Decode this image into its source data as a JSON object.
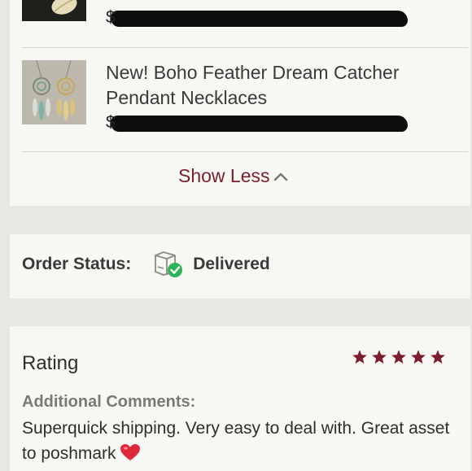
{
  "items": [
    {
      "title": "",
      "price_prefix": "$",
      "thumb_icon": "leaf-pendant-thumbnail"
    },
    {
      "title": "New! Boho Feather Dream Catcher Pendant Necklaces",
      "price_prefix": "$",
      "thumb_icon": "dream-catcher-necklace-thumbnail"
    }
  ],
  "show_less_label": "Show Less",
  "order": {
    "status_label": "Order Status:",
    "status_value": "Delivered",
    "status_icon": "package-delivered-icon"
  },
  "rating": {
    "title": "Rating",
    "stars": 5,
    "max_stars": 5,
    "star_color": "#7a1f2d",
    "comments_label": "Additional Comments:",
    "comments_text": "Superquick shipping. Very easy to deal with. Great asset to poshmark",
    "heart_icon": "red-heart-emoji"
  },
  "colors": {
    "accent": "#7a1f2d",
    "delivered_check": "#2eb35a",
    "background": "#e8e8e2",
    "card": "#f7f7f4"
  }
}
